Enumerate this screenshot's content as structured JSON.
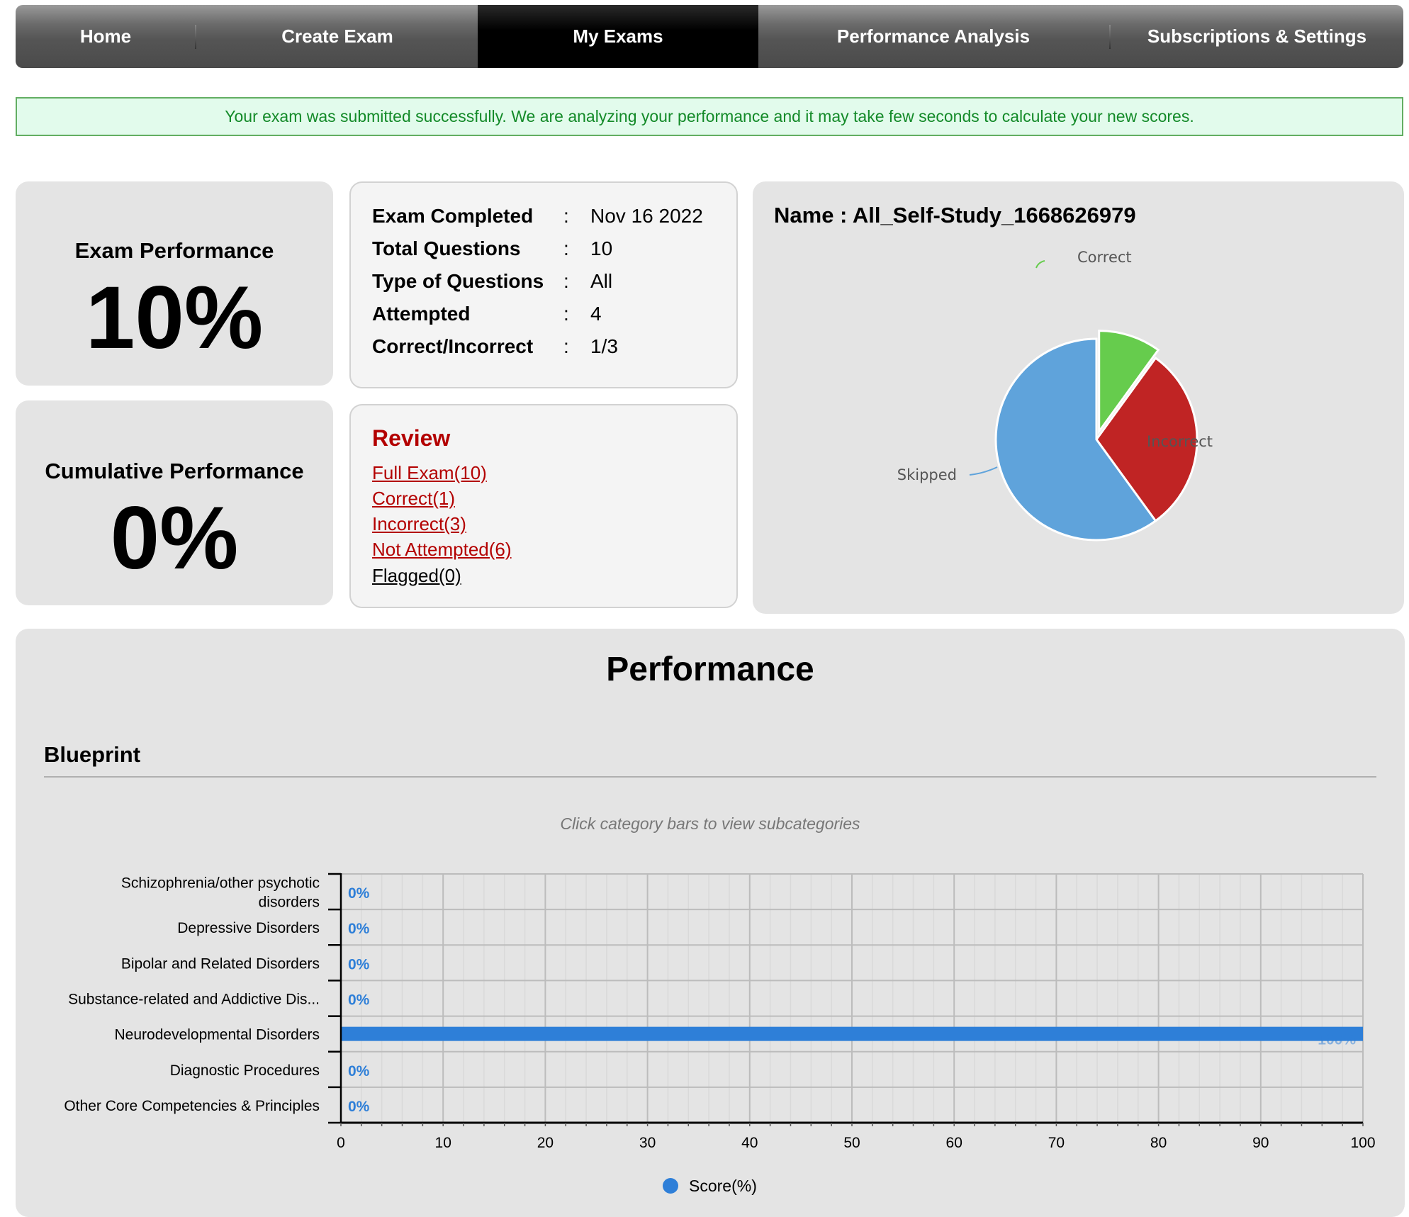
{
  "nav": {
    "items": [
      {
        "label": "Home",
        "active": false
      },
      {
        "label": "Create Exam",
        "active": false
      },
      {
        "label": "My Exams",
        "active": true
      },
      {
        "label": "Performance Analysis",
        "active": false
      },
      {
        "label": "Subscriptions & Settings",
        "active": false
      }
    ]
  },
  "alert": {
    "message": "Your exam was submitted successfully. We are analyzing your performance and it may take few seconds to calculate your new scores."
  },
  "exam_performance": {
    "title": "Exam Performance",
    "value": "10%"
  },
  "cumulative_performance": {
    "title": "Cumulative Performance",
    "value": "0%"
  },
  "exam_info": {
    "rows": [
      {
        "label": "Exam Completed",
        "separator": ":",
        "value": "Nov 16 2022"
      },
      {
        "label": "Total Questions",
        "separator": ":",
        "value": "10"
      },
      {
        "label": "Type of Questions",
        "separator": ":",
        "value": "All"
      },
      {
        "label": "Attempted",
        "separator": ":",
        "value": "4"
      },
      {
        "label": "Correct/Incorrect",
        "separator": ":",
        "value": "1/3"
      }
    ]
  },
  "review": {
    "title": "Review",
    "links": [
      {
        "label": "Full Exam(10)",
        "color": "#b30000"
      },
      {
        "label": "Correct(1)",
        "color": "#b30000"
      },
      {
        "label": "Incorrect(3)",
        "color": "#b30000"
      },
      {
        "label": "Not Attempted(6)",
        "color": "#b30000"
      },
      {
        "label": "Flagged(0)",
        "color": "#000000"
      }
    ]
  },
  "pie_card": {
    "name": "Name : All_Self-Study_1668626979"
  },
  "performance": {
    "heading": "Performance",
    "section": "Blueprint",
    "hint": "Click category bars to view subcategories"
  },
  "chart_data": [
    {
      "type": "pie",
      "title": "",
      "slices": [
        {
          "label": "Correct",
          "value": 1,
          "color": "#66cc4d",
          "exploded": true
        },
        {
          "label": "Incorrect",
          "value": 3,
          "color": "#c02424",
          "exploded": false
        },
        {
          "label": "Skipped",
          "value": 6,
          "color": "#5fa3db",
          "exploded": false
        }
      ]
    },
    {
      "type": "bar",
      "orientation": "horizontal",
      "categories": [
        [
          "Schizophrenia/other psychotic",
          "disorders"
        ],
        [
          "Depressive Disorders"
        ],
        [
          "Bipolar and Related Disorders"
        ],
        [
          "Substance-related and Addictive Dis..."
        ],
        [
          "Neurodevelopmental Disorders"
        ],
        [
          "Diagnostic Procedures"
        ],
        [
          "Other Core Competencies & Principles"
        ]
      ],
      "series": [
        {
          "name": "Score(%)",
          "color": "#2e7fd8",
          "values": [
            0,
            0,
            0,
            0,
            100,
            0,
            0
          ]
        }
      ],
      "value_labels": [
        "0%",
        "0%",
        "0%",
        "0%",
        "100%",
        "0%",
        "0%"
      ],
      "xlim": [
        0,
        100
      ],
      "xticks": [
        0,
        10,
        20,
        30,
        40,
        50,
        60,
        70,
        80,
        90,
        100
      ],
      "xlabel": "",
      "ylabel": "",
      "grid": true,
      "legend": "bottom-center"
    }
  ]
}
